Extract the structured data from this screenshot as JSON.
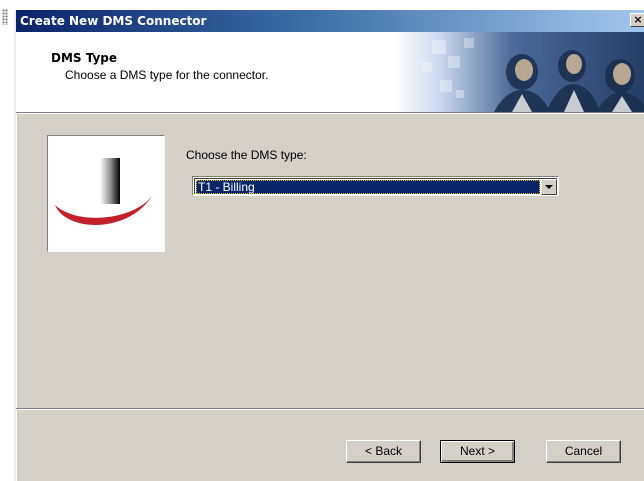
{
  "window": {
    "title": "Create New DMS Connector",
    "close_glyph": "×",
    "close_icon": "close-icon"
  },
  "header": {
    "title": "DMS Type",
    "subtitle": "Choose a DMS type for the connector."
  },
  "body": {
    "prompt_label": "Choose the DMS type:",
    "dms_type": {
      "selected": "T1 - Billing",
      "arrow_icon": "chevron-down-icon"
    }
  },
  "footer": {
    "back_label": "< Back",
    "next_label": "Next >",
    "cancel_label": "Cancel"
  },
  "colors": {
    "titlebar_start": "#0a246a",
    "titlebar_end": "#a6caf0",
    "dialog_face": "#d4d0c8",
    "selection": "#0a246a",
    "logo_swoosh": "#c4202a"
  }
}
